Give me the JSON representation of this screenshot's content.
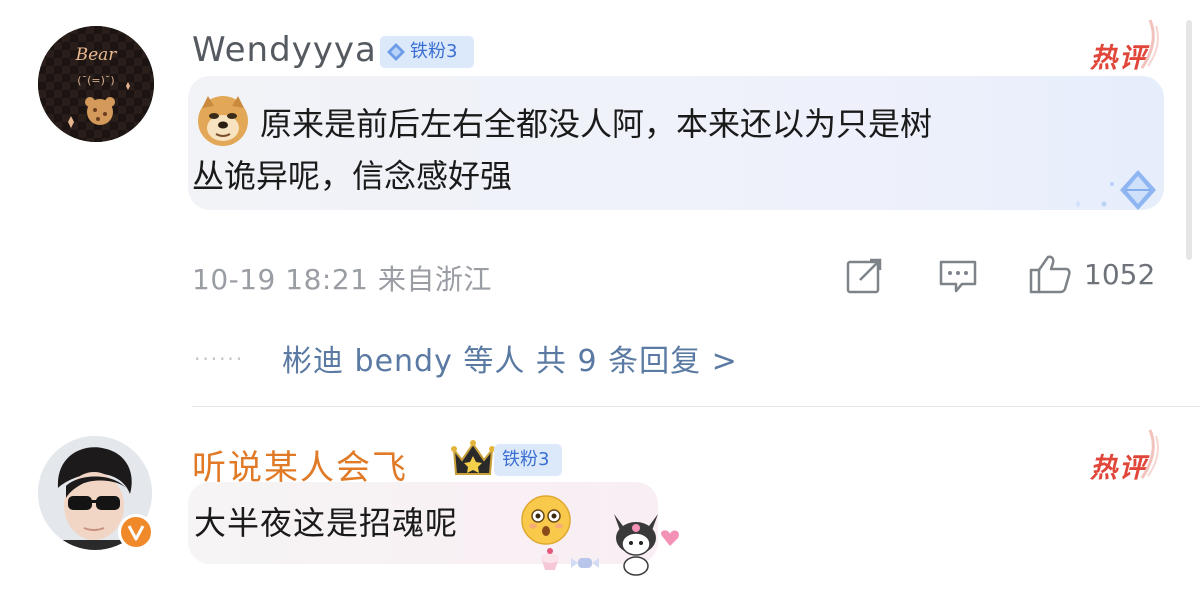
{
  "comments": [
    {
      "username": "Wendyyya",
      "fan_badge": "铁粉3",
      "hot_label": "热评",
      "avatar_text": "Bear",
      "text_line1": "原来是前后左右全都没人阿，本来还以为只是树",
      "text_line2": "丛诡异呢，信念感好强",
      "meta": "10-19 18:21 来自浙江",
      "like_count": "1052",
      "replies": {
        "dots": "······",
        "label": "彬迪 bendy 等人  共 9 条回复 >"
      }
    },
    {
      "username": "听说某人会飞_",
      "fan_badge": "铁粉3",
      "hot_label": "热评",
      "verified_badge": "V",
      "text": "大半夜这是招魂呢"
    }
  ],
  "icons": [
    "doge-emoji-icon",
    "share-icon",
    "comment-icon",
    "like-icon",
    "crown-icon",
    "surprised-emoji-icon",
    "kuromi-sticker-icon",
    "diamond-decoration-icon",
    "verified-badge-icon"
  ],
  "colors": {
    "username_gray": "#555a60",
    "username_orange": "#e07a26",
    "hot_red": "#e0463a",
    "fan_blue": "#3b6fd1",
    "reply_blue": "#5a7aa3",
    "meta_gray": "#9a9ea4"
  }
}
